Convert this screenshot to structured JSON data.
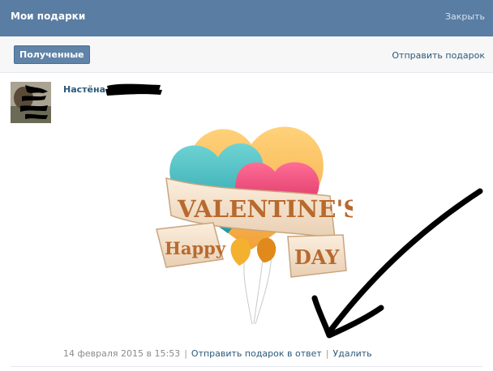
{
  "header": {
    "title": "Мои подарки",
    "close_label": "Закрыть"
  },
  "tabs": {
    "received_label": "Полученные",
    "send_gift_label": "Отправить подарок"
  },
  "gift": {
    "sender_name": "Настёна",
    "image_text": {
      "line1": "VALENTINE'S",
      "line2": "Happy",
      "line3": "DAY"
    },
    "date": "14 февраля 2015 в 15:53",
    "separator": "|",
    "reply_label": "Отправить подарок в ответ",
    "delete_label": "Удалить"
  },
  "colors": {
    "header_bg": "#597da3",
    "link": "#2b587a",
    "button_bg": "#6083a8"
  }
}
